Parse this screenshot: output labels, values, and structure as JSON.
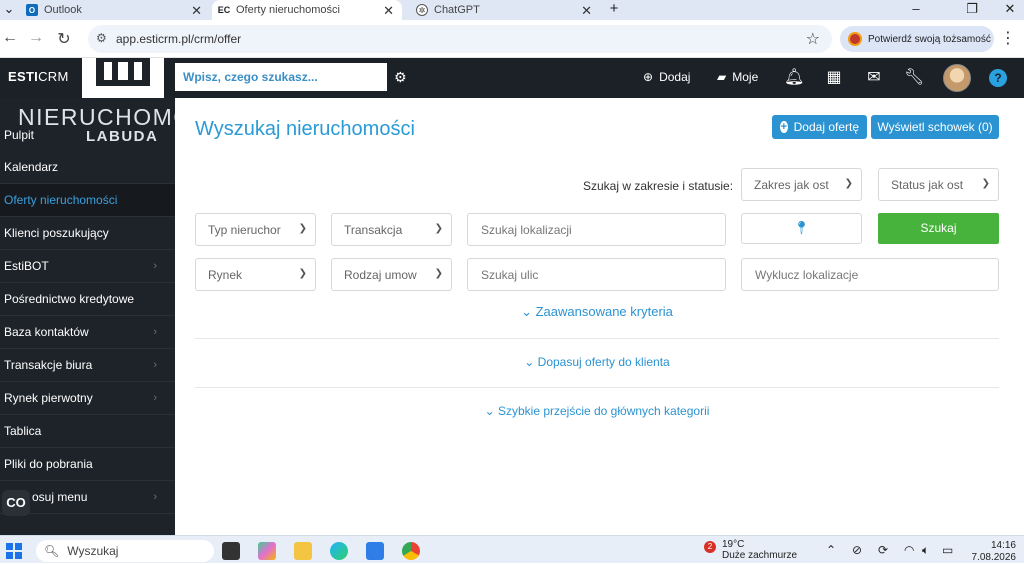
{
  "browser": {
    "tabs": [
      {
        "label": "Outlook",
        "icon": "outlook-icon",
        "active": false
      },
      {
        "label": "Oferty nieruchomości",
        "icon": "esticrm-favicon",
        "active": true
      },
      {
        "label": "ChatGPT",
        "icon": "chatgpt-icon",
        "active": false
      }
    ],
    "url": "app.esticrm.pl/crm/offer",
    "verify_label": "Potwierdź swoją tożsamość"
  },
  "appbar": {
    "brand_bold": "ESTI",
    "brand_light": "CRM",
    "search_placeholder": "Wpisz, czego szukasz...",
    "add_label": "Dodaj",
    "mine_label": "Moje"
  },
  "sidebar": {
    "logo_line1": "NIERUCHOMO",
    "logo_line2": "LABUDA",
    "items": [
      {
        "label": "Pulpit",
        "chevron": false
      },
      {
        "label": "Kalendarz",
        "chevron": false
      },
      {
        "label": "Oferty nieruchomości",
        "chevron": false,
        "active": true
      },
      {
        "label": "Klienci poszukujący",
        "chevron": false
      },
      {
        "label": "EstiBOT",
        "chevron": true
      },
      {
        "label": "Pośrednictwo kredytowe",
        "chevron": false
      },
      {
        "label": "Baza kontaktów",
        "chevron": true
      },
      {
        "label": "Transakcje biura",
        "chevron": true
      },
      {
        "label": "Rynek pierwotny",
        "chevron": true
      },
      {
        "label": "Tablica",
        "chevron": false
      },
      {
        "label": "Pliki do pobrania",
        "chevron": false
      },
      {
        "label": "osuj menu",
        "chevron": true
      }
    ],
    "floating_label": "CO"
  },
  "main": {
    "title": "Wyszukaj nieruchomości",
    "add_offer_label": "Dodaj ofertę",
    "clipboard_label": "Wyświetl schowek (0)",
    "scope_label": "Szukaj w zakresie i statusie:",
    "range_select": "Zakres jak ost",
    "status_select": "Status jak ost",
    "type_select": "Typ nieruchor",
    "transaction_select": "Transakcja",
    "location_placeholder": "Szukaj lokalizacji",
    "search_button": "Szukaj",
    "market_select": "Rynek",
    "contract_select": "Rodzaj umow",
    "street_placeholder": "Szukaj ulic",
    "exclude_placeholder": "Wyklucz lokalizacje",
    "advanced_label": "Zaawansowane kryteria",
    "match_label": "Dopasuj oferty do klienta",
    "quick_label": "Szybkie przejście do głównych kategorii"
  },
  "taskbar": {
    "search_label": "Wyszukaj",
    "weather_temp": "19°C",
    "weather_desc": "Duże zachmurze",
    "weather_badge": "2",
    "time": "14:16",
    "date": "7.08.2026"
  },
  "colors": {
    "accent": "#2b93d1",
    "title": "#2b9ad6",
    "search_green": "#47b33d",
    "sidebar_bg": "#1e2329",
    "topbar_bg": "#1c2127"
  }
}
